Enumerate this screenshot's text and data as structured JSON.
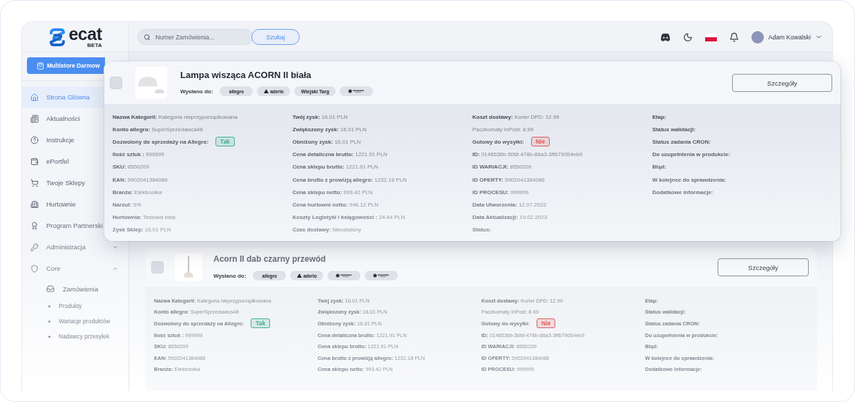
{
  "logo": {
    "name": "ecat",
    "badge": "BETA"
  },
  "sidebar": {
    "promo_button": "Multistore Darmow",
    "items": [
      {
        "label": "Strona Główna",
        "selected": true
      },
      {
        "label": "Aktualności",
        "selected": false
      },
      {
        "label": "Instrukcje",
        "selected": false
      },
      {
        "label": "ePortfel",
        "selected": false
      },
      {
        "label": "Twoje Sklepy",
        "selected": false
      },
      {
        "label": "Hurtownie",
        "selected": false
      },
      {
        "label": "Program Partnerski",
        "selected": false
      },
      {
        "label": "Administracja",
        "selected": false,
        "expanded": false
      },
      {
        "label": "Core",
        "selected": false,
        "expanded": true,
        "children": [
          {
            "label": "Zamówienia",
            "kind": "icon",
            "selected": false
          },
          {
            "label": "Produkty",
            "kind": "bullet",
            "selected": false
          },
          {
            "label": "Wariacje produktów",
            "kind": "bullet",
            "selected": false
          },
          {
            "label": "Nadawcy przesyłek",
            "kind": "bullet",
            "selected": false
          }
        ]
      }
    ]
  },
  "header": {
    "search": {
      "placeholder": "Numer Zamówienia...",
      "button": "Szukaj"
    },
    "user": {
      "name": "Adam Kowalski"
    }
  },
  "products": [
    {
      "raised": true,
      "checked": false,
      "title": "Lampa wisząca ACORN II biała",
      "shipped_label": "Wysłano do:",
      "details_button": "Szczegóły",
      "channels": [
        {
          "kind": "wordmark",
          "label": "allegro"
        },
        {
          "kind": "emblem",
          "label": "aderlo"
        },
        {
          "kind": "wordmark",
          "label": "Wiejski Targ"
        },
        {
          "kind": "logo"
        }
      ],
      "columns": [
        [
          {
            "kind": "field",
            "label": "Nazwa Kategorii:",
            "value": "Kategoria nieprzyporządkowana"
          },
          {
            "kind": "field",
            "label": "Konto allegro:",
            "value": "SuperSprzedawca48"
          },
          {
            "kind": "badge",
            "label": "Dozwolony do sprzedaży na Allegro:",
            "value": "Tak",
            "color": "#3bb08f"
          },
          {
            "kind": "field",
            "label": "Ilość sztuk :",
            "value": "999999"
          },
          {
            "kind": "field",
            "label": "SKU:",
            "value": "8550209"
          },
          {
            "kind": "field",
            "label": "EAN:",
            "value": "5902041384086"
          },
          {
            "kind": "field",
            "label": "Branża:",
            "value": "Elektronika"
          },
          {
            "kind": "field",
            "label": "Narzut:",
            "value": "5%"
          },
          {
            "kind": "field",
            "label": "Hurtownia:",
            "value": "Testowa beta"
          },
          {
            "kind": "field",
            "label": "Zysk Sklep:",
            "value": "16.01 PLN"
          }
        ],
        [
          {
            "kind": "field",
            "label": "Twój zysk:",
            "value": "16.01 PLN"
          },
          {
            "kind": "field",
            "label": "Zwiększony zysk:",
            "value": "16.01 PLN"
          },
          {
            "kind": "field",
            "label": "Obniżony zysk:",
            "value": "16.01 PLN"
          },
          {
            "kind": "field",
            "label": "Cena detaliczna brutto:",
            "value": "1221.91 PLN"
          },
          {
            "kind": "field",
            "label": "Cena sklepu brutto:",
            "value": "1221.91 PLN"
          },
          {
            "kind": "field",
            "label": "Cena brutto z prowizją allegro:",
            "value": "1232.18 PLN"
          },
          {
            "kind": "field",
            "label": "Cena sklepu netto:",
            "value": "993.42 PLN"
          },
          {
            "kind": "field",
            "label": "Cena hurtowni netto:",
            "value": "946.12 PLN"
          },
          {
            "kind": "field",
            "label": "Koszty Logistyki i księgowości :",
            "value": "24.44 PLN"
          },
          {
            "kind": "field",
            "label": "Czas dostawy:",
            "value": "Nieustalony"
          }
        ],
        [
          {
            "kind": "field",
            "label": "Koszt dostawy:",
            "value": "Kurier DPD: 12.99"
          },
          {
            "kind": "note",
            "value": "Paczkomaty InPost: 8.99"
          },
          {
            "kind": "badge",
            "label": "Gotowy do wysyłki:",
            "value": "Nie",
            "color": "#e05a5a"
          },
          {
            "kind": "field",
            "label": "ID:",
            "value": "0146536b-506f-478b-88a3-3ff679054eb9"
          },
          {
            "kind": "field",
            "label": "ID WARIACJI:",
            "value": "8550209"
          },
          {
            "kind": "field",
            "label": "ID OFERTY:",
            "value": "5902041384086"
          },
          {
            "kind": "field",
            "label": "ID PROCESU:",
            "value": "999999"
          },
          {
            "kind": "field",
            "label": "Data Utworzenia:",
            "value": "12.07.2022"
          },
          {
            "kind": "field",
            "label": "Data Aktualizacji:",
            "value": "19.02.2023"
          },
          {
            "kind": "field",
            "label": "Status:"
          }
        ],
        [
          {
            "kind": "field",
            "label": "Etap:"
          },
          {
            "kind": "field",
            "label": "Status walidacji:"
          },
          {
            "kind": "field",
            "label": "Status zadania CRON:"
          },
          {
            "kind": "field",
            "label": "Do uzupełnienia w produkcie:"
          },
          {
            "kind": "field",
            "label": "Błąd:"
          },
          {
            "kind": "field",
            "label": "W kolejnce do sprawdzenia:"
          },
          {
            "kind": "field",
            "label": "Dodatkowe informacje:"
          }
        ]
      ]
    },
    {
      "raised": false,
      "checked": false,
      "title": "Acorn II dab czarny przewód",
      "shipped_label": "Wysłano do:",
      "details_button": "Szczegóły",
      "channels": [
        {
          "kind": "wordmark",
          "label": "allegro"
        },
        {
          "kind": "emblem",
          "label": "aderlo"
        },
        {
          "kind": "logo"
        },
        {
          "kind": "logo"
        }
      ],
      "columns": [
        [
          {
            "kind": "field",
            "label": "Nazwa Kategorii:",
            "value": "Kategoria nieprzyporządkowana"
          },
          {
            "kind": "field",
            "label": "Konto allegro:",
            "value": "SuperSprzedawca48"
          },
          {
            "kind": "badge",
            "label": "Dozwolony do sprzedaży na Allegro:",
            "value": "Tak",
            "color": "#3bb08f"
          },
          {
            "kind": "field",
            "label": "Ilość sztuk :",
            "value": "999999"
          },
          {
            "kind": "field",
            "label": "SKU:",
            "value": "8550209"
          },
          {
            "kind": "field",
            "label": "EAN:",
            "value": "5902041384086"
          },
          {
            "kind": "field",
            "label": "Branża:",
            "value": "Elektronika"
          }
        ],
        [
          {
            "kind": "field",
            "label": "Twój zysk:",
            "value": "16.01 PLN"
          },
          {
            "kind": "field",
            "label": "Zwiększony zysk:",
            "value": "16.01 PLN"
          },
          {
            "kind": "field",
            "label": "Obniżony zysk:",
            "value": "16.01 PLN"
          },
          {
            "kind": "field",
            "label": "Cena detaliczna brutto:",
            "value": "1221.91 PLN"
          },
          {
            "kind": "field",
            "label": "Cena sklepu brutto:",
            "value": "1221.91 PLN"
          },
          {
            "kind": "field",
            "label": "Cena brutto z prowizją allegro:",
            "value": "1232.18 PLN"
          },
          {
            "kind": "field",
            "label": "Cena sklepu netto:",
            "value": "993.42 PLN"
          }
        ],
        [
          {
            "kind": "field",
            "label": "Koszt dostawy:",
            "value": "Kurier DPD: 12.99"
          },
          {
            "kind": "note",
            "value": "Paczkomaty InPost: 8.99"
          },
          {
            "kind": "badge",
            "label": "Gotowy do wysyłki:",
            "value": "Nie",
            "color": "#e05a5a"
          },
          {
            "kind": "field",
            "label": "ID:",
            "value": "0146536b-506f-478b-88a3-3ff679054eb9"
          },
          {
            "kind": "field",
            "label": "ID WARIACJI:",
            "value": "8550209"
          },
          {
            "kind": "field",
            "label": "ID OFERTY:",
            "value": "5902041384086"
          },
          {
            "kind": "field",
            "label": "ID PROCESU:",
            "value": "999999"
          }
        ],
        [
          {
            "kind": "field",
            "label": "Etap:"
          },
          {
            "kind": "field",
            "label": "Status walidacji:"
          },
          {
            "kind": "field",
            "label": "Status zadania CRON:"
          },
          {
            "kind": "field",
            "label": "Do uzupełnienia w produkcie:"
          },
          {
            "kind": "field",
            "label": "Błąd:"
          },
          {
            "kind": "field",
            "label": "W kolejnce do sprawdzenia:"
          },
          {
            "kind": "field",
            "label": "Dodatkowe informacje:"
          }
        ]
      ]
    }
  ]
}
